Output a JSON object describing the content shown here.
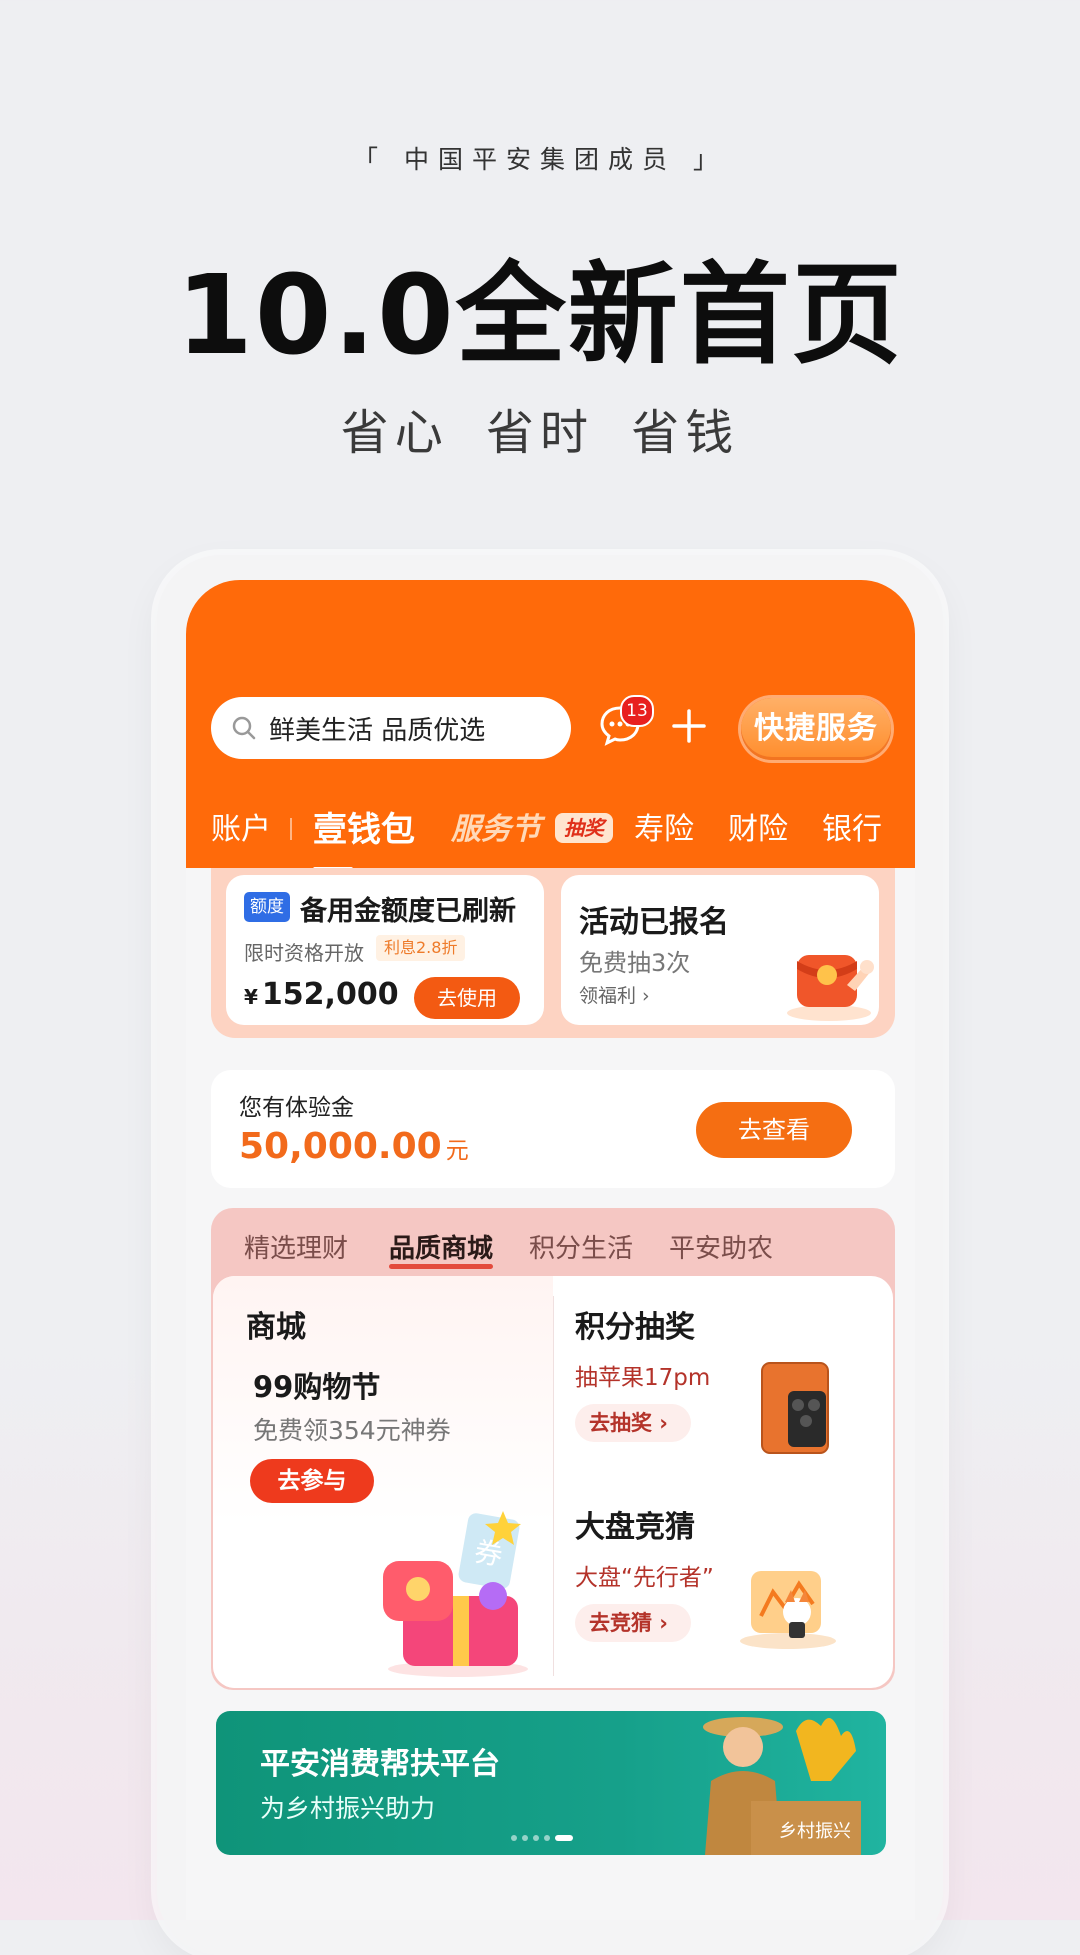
{
  "promo": {
    "tagline": "「 中国平安集团成员 」",
    "headline": "10.0全新首页",
    "sub1": "省心",
    "sub2": "省时",
    "sub3": "省钱"
  },
  "header": {
    "search_placeholder": "鲜美生活 品质优选",
    "message_count": "13",
    "quick_service": "快捷服务",
    "tabs": [
      {
        "label": "账户"
      },
      {
        "label": "壹钱包"
      },
      {
        "label": "服务节"
      },
      {
        "label": "寿险"
      },
      {
        "label": "财险"
      },
      {
        "label": "银行"
      }
    ],
    "lottery_tag": "抽奖"
  },
  "cards": {
    "reserve": {
      "tag": "额度",
      "title": "备用金额度已刷新",
      "subtitle": "限时资格开放",
      "rate": "利息2.8折",
      "currency": "¥",
      "amount": "152,000",
      "button": "去使用"
    },
    "activity": {
      "title": "活动已报名",
      "subtitle": "免费抽3次",
      "link": "领福利 ›"
    }
  },
  "experience": {
    "label": "您有体验金",
    "amount": "50,000.00",
    "unit": "元",
    "button": "去查看"
  },
  "mall": {
    "tabs": [
      "精选理财",
      "品质商城",
      "积分生活",
      "平安助农"
    ],
    "left": {
      "title": "商城",
      "event": "99购物节",
      "desc": "免费领354元神券",
      "button": "去参与"
    },
    "lottery": {
      "title": "积分抽奖",
      "desc": "抽苹果17pm",
      "button": "去抽奖 ›"
    },
    "guess": {
      "title": "大盘竞猜",
      "desc": "大盘“先行者”",
      "button": "去竞猜 ›"
    }
  },
  "banner": {
    "title": "平安消费帮扶平台",
    "subtitle": "为乡村振兴助力",
    "box_text": "乡村振兴"
  },
  "colors": {
    "brand_orange": "#ff6a0a",
    "accent_red": "#ee3a1d",
    "banner_green": "#129a80"
  }
}
